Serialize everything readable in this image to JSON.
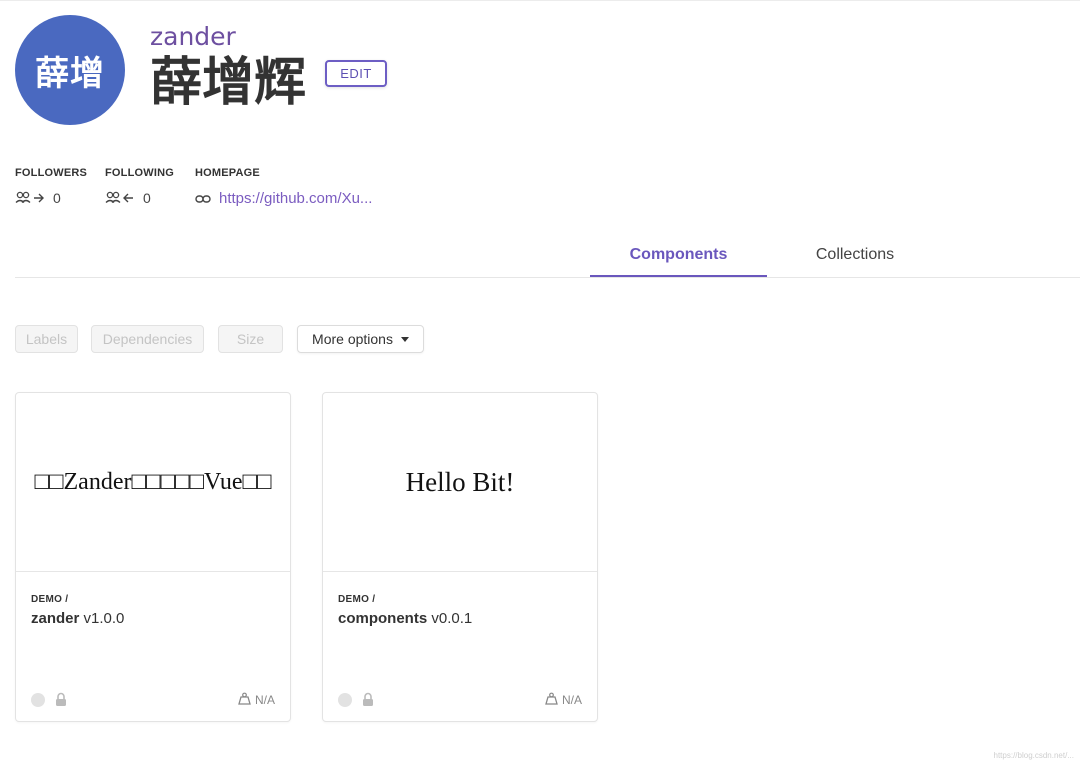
{
  "profile": {
    "avatar_text": "薛增",
    "username": "zander",
    "display_name": "薛增辉",
    "edit_label": "EDIT"
  },
  "stats": {
    "followers_label": "FOLLOWERS",
    "followers_count": "0",
    "following_label": "FOLLOWING",
    "following_count": "0",
    "homepage_label": "HOMEPAGE",
    "homepage_url": "https://github.com/Xu..."
  },
  "tabs": [
    {
      "label": "Components",
      "active": true
    },
    {
      "label": "Collections",
      "active": false
    }
  ],
  "filters": {
    "labels": "Labels",
    "dependencies": "Dependencies",
    "size": "Size",
    "more_options": "More options"
  },
  "cards": [
    {
      "preview_text": "□□Zander□□□□□Vue□□",
      "scope": "DEMO /",
      "name": "zander",
      "version": "v1.0.0",
      "size": "N/A"
    },
    {
      "preview_text": "Hello Bit!",
      "scope": "DEMO /",
      "name": "components",
      "version": "v0.0.1",
      "size": "N/A"
    }
  ],
  "colors": {
    "accent": "#6a57bd",
    "avatar_bg": "#4a69c0",
    "link": "#7b5cc0"
  },
  "icons": {
    "followers": "users-arrow-right-icon",
    "following": "users-arrow-left-icon",
    "homepage": "link-icon",
    "visibility": "lock-icon",
    "size": "weight-icon",
    "dropdown": "caret-down-icon"
  },
  "watermark": "https://blog.csdn.net/..."
}
